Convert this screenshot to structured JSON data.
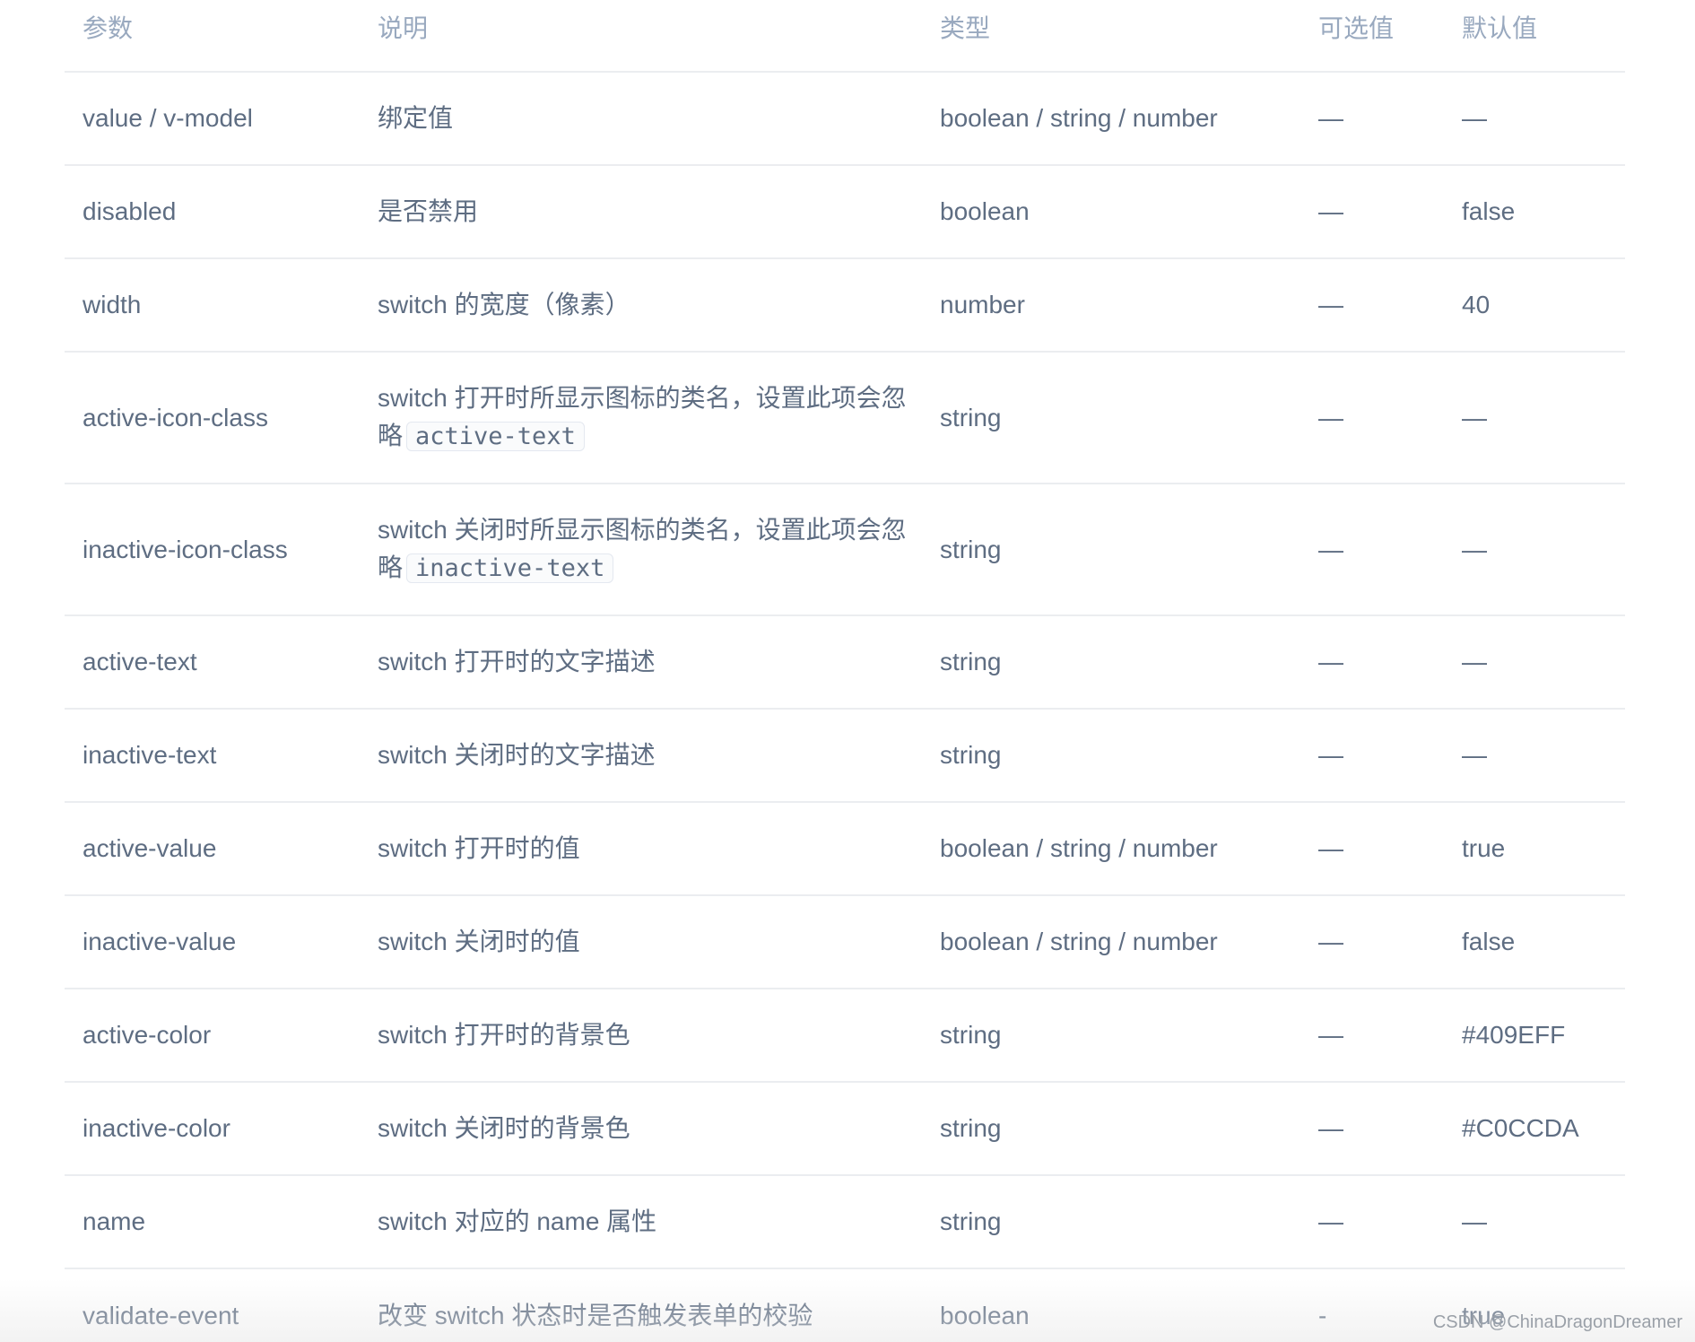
{
  "table": {
    "headers": [
      "参数",
      "说明",
      "类型",
      "可选值",
      "默认值"
    ],
    "rows": [
      {
        "param": "value / v-model",
        "desc": "绑定值",
        "type": "boolean / string / number",
        "options": "—",
        "default": "—"
      },
      {
        "param": "disabled",
        "desc": "是否禁用",
        "type": "boolean",
        "options": "—",
        "default": "false"
      },
      {
        "param": "width",
        "desc": "switch 的宽度（像素）",
        "type": "number",
        "options": "—",
        "default": "40"
      },
      {
        "param": "active-icon-class",
        "desc": "switch 打开时所显示图标的类名，设置此项会忽略",
        "desc_code": "active-text",
        "type": "string",
        "options": "—",
        "default": "—"
      },
      {
        "param": "inactive-icon-class",
        "desc": "switch 关闭时所显示图标的类名，设置此项会忽略",
        "desc_code": "inactive-text",
        "type": "string",
        "options": "—",
        "default": "—"
      },
      {
        "param": "active-text",
        "desc": "switch 打开时的文字描述",
        "type": "string",
        "options": "—",
        "default": "—"
      },
      {
        "param": "inactive-text",
        "desc": "switch 关闭时的文字描述",
        "type": "string",
        "options": "—",
        "default": "—"
      },
      {
        "param": "active-value",
        "desc": "switch 打开时的值",
        "type": "boolean / string / number",
        "options": "—",
        "default": "true"
      },
      {
        "param": "inactive-value",
        "desc": "switch 关闭时的值",
        "type": "boolean / string / number",
        "options": "—",
        "default": "false"
      },
      {
        "param": "active-color",
        "desc": "switch 打开时的背景色",
        "type": "string",
        "options": "—",
        "default": "#409EFF"
      },
      {
        "param": "inactive-color",
        "desc": "switch 关闭时的背景色",
        "type": "string",
        "options": "—",
        "default": "#C0CCDA"
      },
      {
        "param": "name",
        "desc": "switch 对应的 name 属性",
        "type": "string",
        "options": "—",
        "default": "—"
      },
      {
        "param": "validate-event",
        "desc": "改变 switch 状态时是否触发表单的校验",
        "type": "boolean",
        "options": "-",
        "default": "true"
      }
    ]
  },
  "watermark": "CSDN @ChinaDragonDreamer",
  "colors": {
    "text": "#5e6d82",
    "header_text": "#99a9bf",
    "border": "#ebedf0"
  }
}
